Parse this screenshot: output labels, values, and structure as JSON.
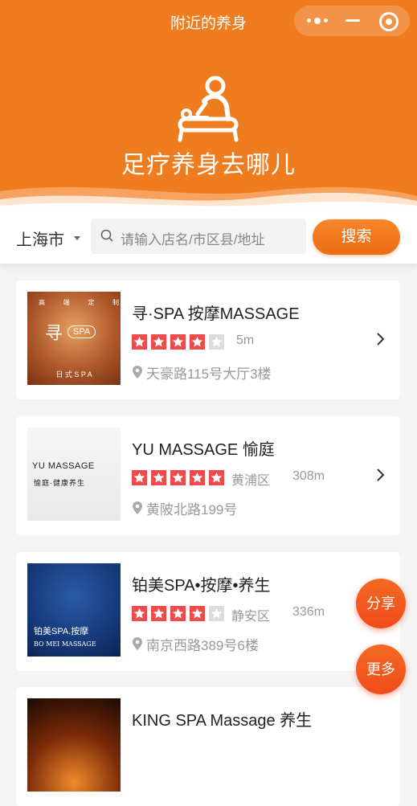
{
  "header": {
    "title": "附近的养身",
    "slogan": "足疗养身去哪儿",
    "background_color": "#f07c20",
    "logo_icon": "massage-person-icon"
  },
  "capsule": {
    "more_icon": "more-dots-icon",
    "minimize_icon": "minimize-icon",
    "close_icon": "target-close-icon"
  },
  "search": {
    "city": "上海市",
    "placeholder": "请输入店名/市区县/地址",
    "button_label": "搜索"
  },
  "shops": [
    {
      "name": "寻·SPA 按摩MASSAGE",
      "rating": 4,
      "district": "",
      "distance": "5m",
      "address": "天豪路115号大厅3楼",
      "thumb_text": [
        "高",
        "端",
        "定",
        "制"
      ],
      "thumb_logo": "寻",
      "thumb_logo_sub": "SPA",
      "thumb_caption": "日 式 S P A"
    },
    {
      "name": "YU MASSAGE 愉庭",
      "rating": 5,
      "district": "黄浦区",
      "distance": "308m",
      "address": "黄陂北路199号",
      "thumb_logo": "YU MASSAGE",
      "thumb_caption": "愉庭·健康养生"
    },
    {
      "name": "铂美SPA•按摩•养生",
      "rating": 4,
      "district": "静安区",
      "distance": "336m",
      "address": "南京西路389号6楼",
      "thumb_logo": "铂美SPA.按摩",
      "thumb_caption": "BO MEI MASSAGE"
    },
    {
      "name": "KING SPA Massage 养生",
      "rating": 0,
      "district": "",
      "distance": "",
      "address": ""
    }
  ],
  "fab": {
    "share_label": "分享",
    "more_label": "更多"
  },
  "colors": {
    "accent": "#f07c20",
    "star": "#f04b4b",
    "star_empty": "#dddddd",
    "fab": "#f24b1a"
  }
}
